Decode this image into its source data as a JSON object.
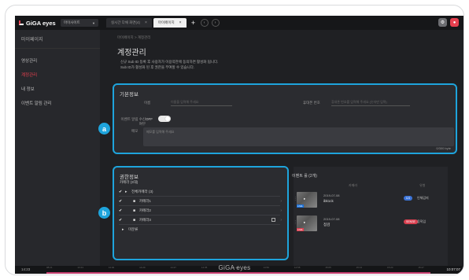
{
  "brand": {
    "name": "GiGA eyes",
    "footer": "GiGA eyes"
  },
  "topbar": {
    "site_select": "마이사이트",
    "tabs": [
      {
        "label": "실시간 다채 화면(4)",
        "active": false
      },
      {
        "label": "마이페이지",
        "active": true
      }
    ]
  },
  "sidebar": {
    "title": "마이페이지",
    "items": [
      {
        "label": "영상관리",
        "active": false
      },
      {
        "label": "계정관리",
        "active": true
      },
      {
        "label": "내 정보",
        "active": false
      },
      {
        "label": "이벤트 알림 관리",
        "active": false
      }
    ]
  },
  "main": {
    "breadcrumb": "마이페이지 > 계정관리",
    "title": "계정관리",
    "desc_line1": "신규 Sub ID 등록 후 사용자가 이용약관에 동의하면 활성화 됩니다.",
    "desc_line2": "Sub ID가 활성화 된 후 권한을 부여할 수 있습니다."
  },
  "basic": {
    "title": "기본정보",
    "name_label": "이름",
    "name_placeholder": "이름을 입력해 주세요",
    "phone_label": "휴대폰 번호",
    "phone_placeholder": "휴대폰 번호를 입력해 주세요 (숫자만 입력)",
    "alarm_label": "이벤트 알림 수신 여부",
    "alarm_state": "OFF",
    "memo_label": "메모",
    "memo_placeholder": "메모를 입력해 주세요",
    "counter": "0/300 byte"
  },
  "perm": {
    "title": "권한정보",
    "subtitle": "카메라 (3대)",
    "tree": [
      {
        "label": "전체카메라 (3)",
        "icon": "folder-icon",
        "checked": true
      },
      {
        "label": "카메라1",
        "icon": "camera-icon",
        "checked": true
      },
      {
        "label": "카메라2",
        "icon": "camera-icon",
        "checked": true
      },
      {
        "label": "카메라3",
        "icon": "camera-icon",
        "checked": true
      },
      {
        "label": "미분류",
        "icon": "folder-icon",
        "checked": false
      }
    ]
  },
  "event": {
    "title": "이벤트 룰 (2개)",
    "col_camera": "카메라",
    "col_type": "유형",
    "rows": [
      {
        "date": "2019-07-08",
        "camera": "ibk1ck",
        "badge": "iLS",
        "type": "인체감지",
        "tag": "LIVE"
      },
      {
        "date": "2019-07-08",
        "camera": "점검",
        "badge": "SENSE",
        "type": "움직임",
        "tag": "LIVE"
      }
    ]
  },
  "callouts": {
    "a": "a",
    "b": "b"
  },
  "timeline": {
    "label": "14:23",
    "clock": "10:07:07",
    "ticks": [
      "08:21",
      "13:44",
      "14:02",
      "14:20",
      "14:27",
      "14:35",
      "14:43",
      "14:50",
      "14:58",
      "15:05",
      "15:13",
      "15:20",
      "15:27"
    ]
  },
  "colors": {
    "accent": "#1ea4dc",
    "brand_red": "#e6404f",
    "timeline": "#c43c6d"
  }
}
